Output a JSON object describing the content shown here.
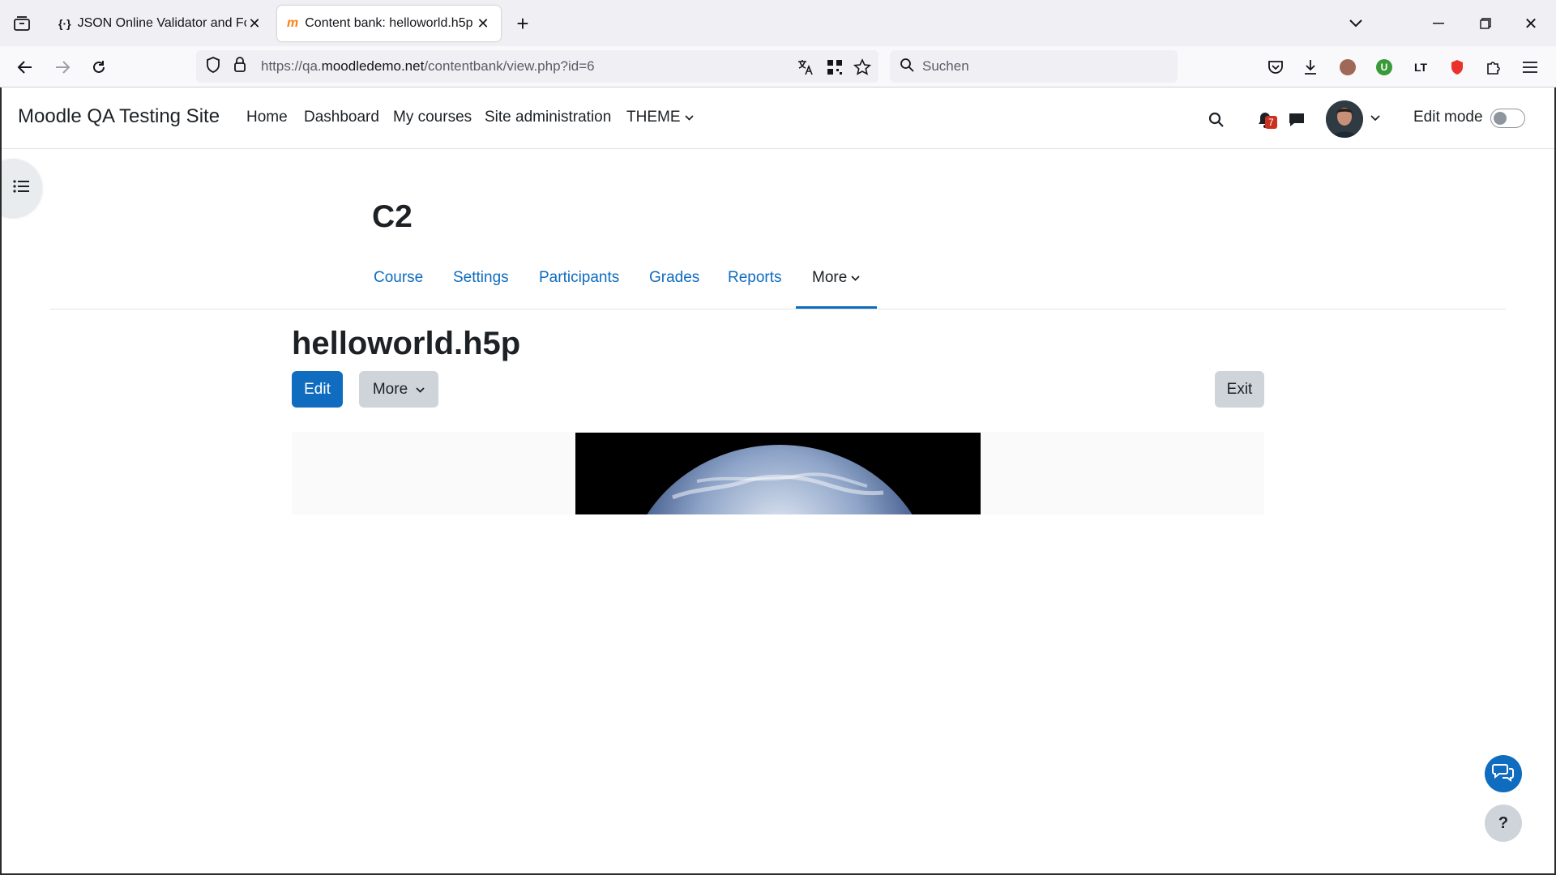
{
  "browser": {
    "tabs": [
      {
        "label": "JSON Online Validator and Form",
        "icon": "json-brackets-icon"
      },
      {
        "label": "Content bank: helloworld.h5p |",
        "icon": "moodle-logo-icon"
      }
    ],
    "url_prefix": "https://qa.",
    "url_domain": "moodledemo.net",
    "url_path": "/contentbank/view.php?id=6",
    "search_placeholder": "Suchen"
  },
  "header": {
    "site_name": "Moodle QA Testing Site",
    "nav": [
      "Home",
      "Dashboard",
      "My courses",
      "Site administration",
      "THEME"
    ],
    "notification_count": "7",
    "edit_mode_label": "Edit mode"
  },
  "course": {
    "title": "C2",
    "tabs": [
      "Course",
      "Settings",
      "Participants",
      "Grades",
      "Reports",
      "More"
    ]
  },
  "content": {
    "title": "helloworld.h5p",
    "edit_label": "Edit",
    "more_label": "More",
    "exit_label": "Exit"
  },
  "help_label": "?",
  "colors": {
    "primary": "#0f6cbf",
    "secondary": "#ced4da",
    "badge": "#ca3120"
  }
}
